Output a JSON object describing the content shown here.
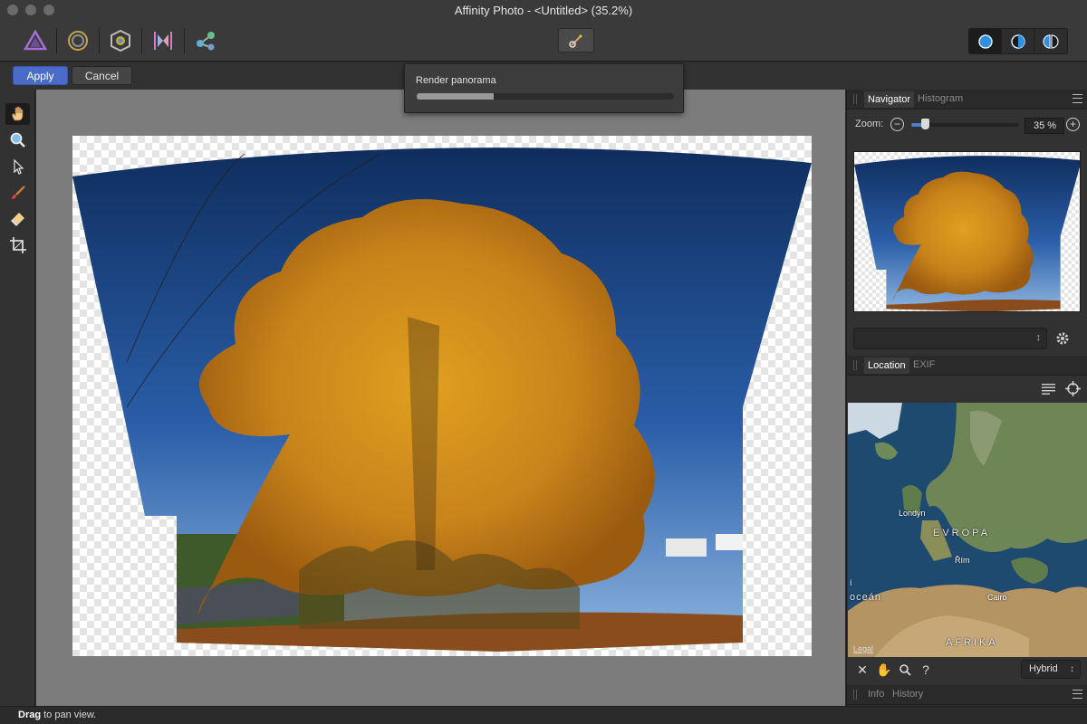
{
  "window": {
    "title": "Affinity Photo - <Untitled> (35.2%)"
  },
  "personas": [
    "photo-persona",
    "liquify-persona",
    "develop-persona",
    "tone-mapping-persona",
    "export-persona"
  ],
  "context_toolbar": {
    "apply_label": "Apply",
    "cancel_label": "Cancel"
  },
  "render_popup": {
    "label": "Render panorama",
    "progress": 0.3
  },
  "tools": [
    "view-tool",
    "zoom-tool",
    "move-tool",
    "paint-brush-tool",
    "erase-brush-tool",
    "crop-tool"
  ],
  "navigator": {
    "tabs": [
      "Navigator",
      "Histogram"
    ],
    "zoom_label": "Zoom:",
    "zoom_value": "35 %",
    "zoom_fraction": 0.13
  },
  "location": {
    "tabs": [
      "Location",
      "EXIF"
    ],
    "labels": {
      "london": "Londýn",
      "europe": "EVROPA",
      "rome": "Řím",
      "ocean": "oceán",
      "cairo": "Cairo",
      "africa": "AFRIKA",
      "ocean_prefix": "í"
    },
    "legal": "Legal",
    "map_type": "Hybrid"
  },
  "bottom_panel": {
    "tabs": [
      "Info",
      "History"
    ]
  },
  "status": {
    "bold": "Drag",
    "text": " to pan view."
  }
}
